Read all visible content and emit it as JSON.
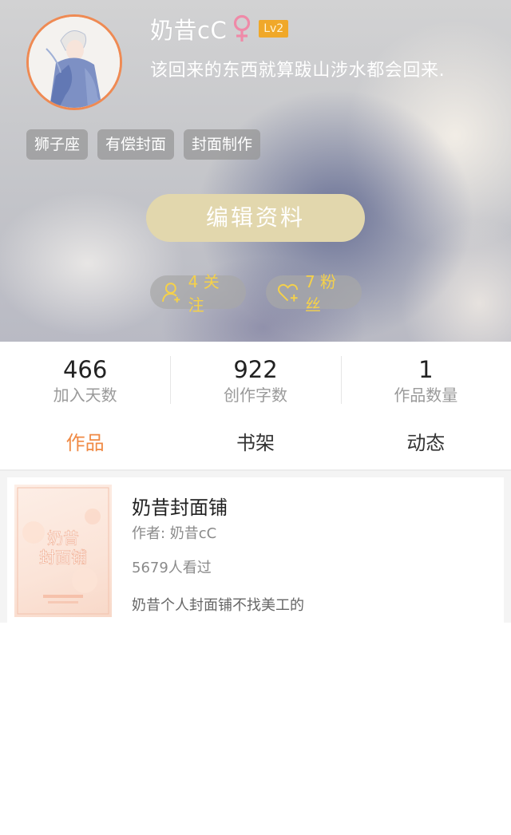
{
  "profile": {
    "username": "奶昔cC",
    "gender_icon": "female-symbol-icon",
    "level": "Lv2",
    "signature": "该回来的东西就算跋山涉水都会回来.",
    "tags": [
      "狮子座",
      "有偿封面",
      "封面制作"
    ],
    "edit_button": "编辑资料",
    "following": "4 关注",
    "fans": "7 粉丝",
    "colors": {
      "avatar_border": "#ef8a53",
      "level_badge": "#f0a829",
      "social_text": "#f5d14a",
      "edit_button": "#e2d7ad"
    }
  },
  "stats": [
    {
      "value": "466",
      "label": "加入天数"
    },
    {
      "value": "922",
      "label": "创作字数"
    },
    {
      "value": "1",
      "label": "作品数量"
    }
  ],
  "tabs": [
    {
      "label": "作品",
      "active": true
    },
    {
      "label": "书架",
      "active": false
    },
    {
      "label": "动态",
      "active": false
    }
  ],
  "accent_color": "#f08a45",
  "works": [
    {
      "title": "奶昔封面铺",
      "author": "作者: 奶昔cC",
      "views": "5679人看过",
      "description": "奶昔个人封面铺不找美工的",
      "cover_text": "奶昔封面铺"
    }
  ]
}
